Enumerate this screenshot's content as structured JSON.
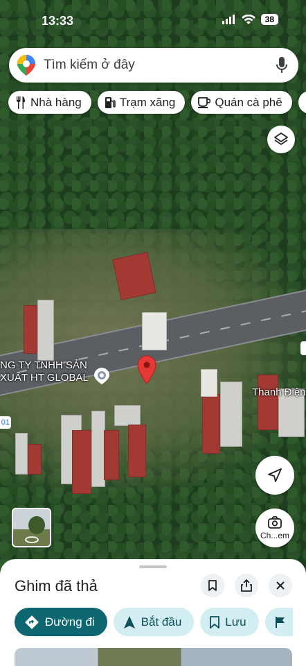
{
  "status_bar": {
    "time": "13:33",
    "battery": "38"
  },
  "search": {
    "placeholder": "Tìm kiếm ở đây"
  },
  "chips": [
    {
      "label": "Nhà hàng",
      "icon": "fork-knife-icon"
    },
    {
      "label": "Trạm xăng",
      "icon": "gas-station-icon"
    },
    {
      "label": "Quán cà phê",
      "icon": "coffee-icon"
    }
  ],
  "map": {
    "place_label_line1": "NG TY TNHH SẢN",
    "place_label_line2": "XUẤT HT GLOBAL",
    "right_label": "Thanh Điện",
    "road_badge": "01",
    "camera_label": "Ch...em"
  },
  "sheet": {
    "title": "Ghim đã thả",
    "actions": [
      {
        "label": "Đường đi",
        "icon": "directions-icon"
      },
      {
        "label": "Bắt đầu",
        "icon": "navigation-arrow-icon"
      },
      {
        "label": "Lưu",
        "icon": "bookmark-icon"
      }
    ]
  },
  "colors": {
    "accent": "#0d6670",
    "pin": "#e53935",
    "action_bg": "#d3eef2"
  }
}
